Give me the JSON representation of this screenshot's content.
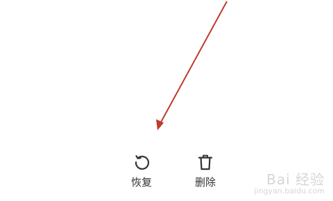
{
  "actions": {
    "restore": {
      "label": "恢复",
      "icon": "restore-icon"
    },
    "delete": {
      "label": "删除",
      "icon": "trash-icon"
    }
  },
  "annotation": {
    "color": "#c0392b",
    "shape": "arrow pointing down-left"
  },
  "watermark": {
    "logo": "Bai 经验",
    "url": "jingyan.baidu.com"
  }
}
